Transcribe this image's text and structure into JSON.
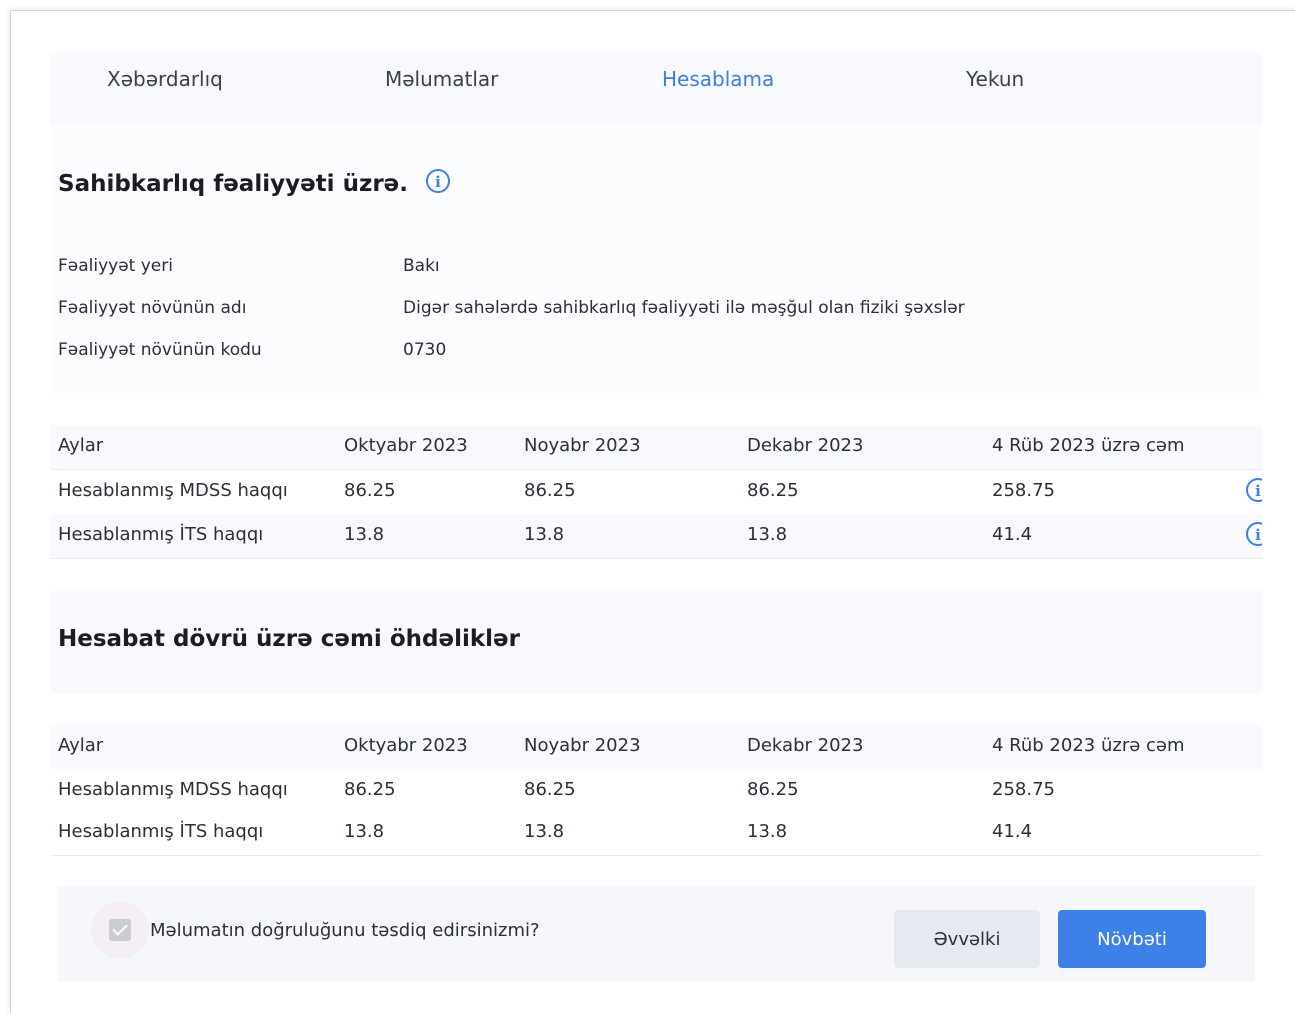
{
  "tabs": [
    {
      "label": "Xəbərdarlıq",
      "active": false
    },
    {
      "label": "Məlumatlar",
      "active": false
    },
    {
      "label": "Hesablama",
      "active": true
    },
    {
      "label": "Yekun",
      "active": false
    }
  ],
  "section1": {
    "title": "Sahibkarlıq fəaliyyəti üzrə.",
    "info_icon": "i",
    "fields": [
      {
        "label": "Fəaliyyət yeri",
        "value": "Bakı"
      },
      {
        "label": "Fəaliyyət növünün adı",
        "value": "Digər sahələrdə sahibkarlıq fəaliyyəti ilə məşğul olan fiziki şəxslər"
      },
      {
        "label": "Fəaliyyət növünün kodu",
        "value": "0730"
      }
    ]
  },
  "table1": {
    "headers": [
      "Aylar",
      "Oktyabr 2023",
      "Noyabr 2023",
      "Dekabr 2023",
      "4 Rüb 2023 üzrə cəm"
    ],
    "rows": [
      [
        "Hesablanmış MDSS haqqı",
        "86.25",
        "86.25",
        "86.25",
        "258.75"
      ],
      [
        "Hesablanmış İTS haqqı",
        "13.8",
        "13.8",
        "13.8",
        "41.4"
      ]
    ],
    "row_icon": "i"
  },
  "section2": {
    "title": "Hesabat dövrü üzrə cəmi öhdəliklər"
  },
  "table2": {
    "headers": [
      "Aylar",
      "Oktyabr 2023",
      "Noyabr 2023",
      "Dekabr 2023",
      "4 Rüb 2023 üzrə cəm"
    ],
    "rows": [
      [
        "Hesablanmış MDSS haqqı",
        "86.25",
        "86.25",
        "86.25",
        "258.75"
      ],
      [
        "Hesablanmış İTS haqqı",
        "13.8",
        "13.8",
        "13.8",
        "41.4"
      ]
    ]
  },
  "footer": {
    "confirm_label": "Məlumatın doğruluğunu təsdiq edirsinizmi?",
    "prev_label": "Əvvəlki",
    "next_label": "Növbəti"
  },
  "colors": {
    "accent": "#3d80e8",
    "panel": "#f7f9fc"
  }
}
